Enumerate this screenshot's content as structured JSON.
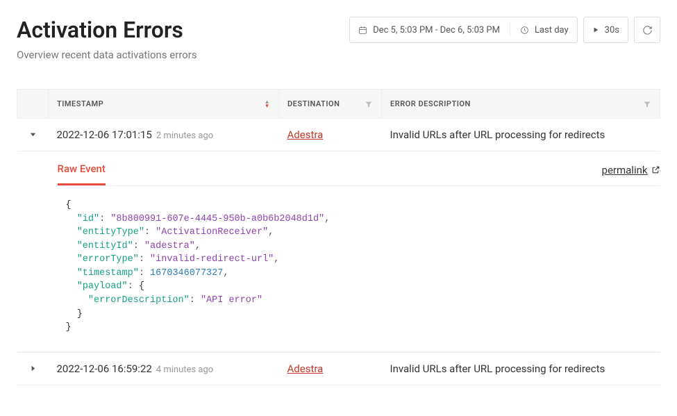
{
  "header": {
    "title": "Activation Errors",
    "subtitle": "Overview recent data activations errors"
  },
  "toolbar": {
    "date_range": "Dec 5, 5:03 PM - Dec 6, 5:03 PM",
    "relative_range": "Last day",
    "refresh_interval": "30s"
  },
  "columns": {
    "expand": "",
    "timestamp": "TIMESTAMP",
    "destination": "DESTINATION",
    "error_description": "ERROR DESCRIPTION"
  },
  "rows": [
    {
      "expanded": true,
      "timestamp": "2022-12-06 17:01:15",
      "relative": "2 minutes ago",
      "destination": "Adestra",
      "error_description": "Invalid URLs after URL processing for redirects",
      "detail": {
        "tab_label": "Raw Event",
        "permalink_label": "permalink",
        "json": {
          "id": "8b800991-607e-4445-950b-a0b6b2048d1d",
          "entityType": "ActivationReceiver",
          "entityId": "adestra",
          "errorType": "invalid-redirect-url",
          "timestamp": 1670346077327,
          "payload": {
            "errorDescription": "API error"
          }
        }
      }
    },
    {
      "expanded": false,
      "timestamp": "2022-12-06 16:59:22",
      "relative": "4 minutes ago",
      "destination": "Adestra",
      "error_description": "Invalid URLs after URL processing for redirects"
    }
  ]
}
